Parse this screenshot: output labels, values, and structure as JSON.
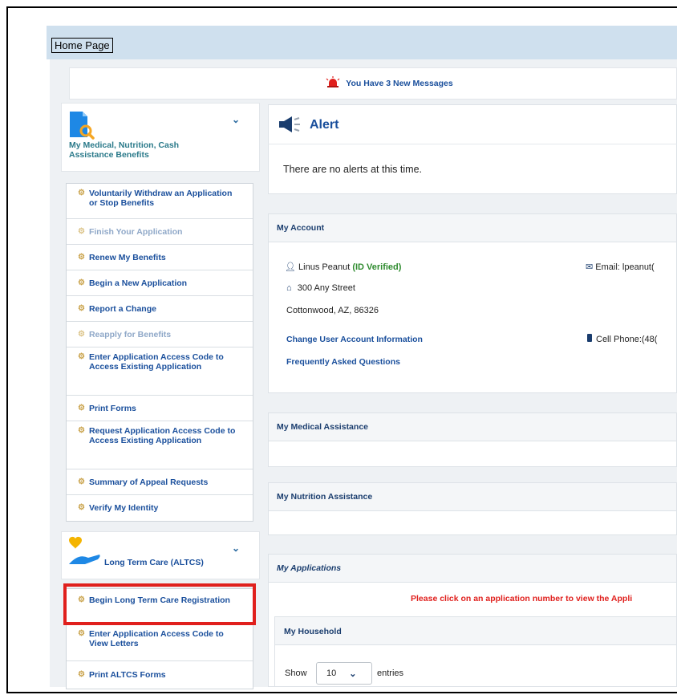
{
  "header": {
    "home_label": "Home Page"
  },
  "messages": {
    "text": "You Have 3 New Messages"
  },
  "sidebar": {
    "section1_title": "My Medical, Nutrition, Cash Assistance Benefits",
    "items": [
      {
        "label": "Voluntarily Withdraw an Application or Stop Benefits"
      },
      {
        "label": "Finish Your Application"
      },
      {
        "label": "Renew My Benefits"
      },
      {
        "label": "Begin a New Application"
      },
      {
        "label": "Report a Change"
      },
      {
        "label": "Reapply for Benefits"
      },
      {
        "label": "Enter Application Access Code to Access Existing Application"
      },
      {
        "label": "Print Forms"
      },
      {
        "label": "Request Application Access Code to Access Existing Application"
      },
      {
        "label": "Summary of Appeal Requests"
      },
      {
        "label": "Verify My Identity"
      }
    ],
    "section2_title": "Long Term Care (ALTCS)",
    "items2": [
      {
        "label": "Begin Long Term Care Registration"
      },
      {
        "label": "Enter Application Access Code to View Letters"
      },
      {
        "label": "Print ALTCS Forms"
      }
    ]
  },
  "alert": {
    "title": "Alert",
    "text": "There are no alerts at this time."
  },
  "account": {
    "title": "My Account",
    "name": "Linus Peanut",
    "verified": "(ID Verified)",
    "street": "300 Any Street",
    "city": "Cottonwood, AZ, 86326",
    "email_label": "Email: lpeanut(",
    "phone_label": "Cell Phone:(48(",
    "change_link": "Change User Account Information",
    "faq_link": "Frequently Asked Questions"
  },
  "medical": {
    "title": "My Medical Assistance"
  },
  "nutrition": {
    "title": "My Nutrition Assistance"
  },
  "applications": {
    "title": "My Applications",
    "note": "Please click on an application number to view the Appli"
  },
  "household": {
    "title": "My Household",
    "show_label": "Show",
    "entries_value": "10",
    "entries_label": "entries"
  },
  "colors": {
    "accent": "#1a4f9c",
    "alert_red": "#e0201d",
    "verified_green": "#2e8b2e",
    "topbar": "#cfe0ee"
  }
}
